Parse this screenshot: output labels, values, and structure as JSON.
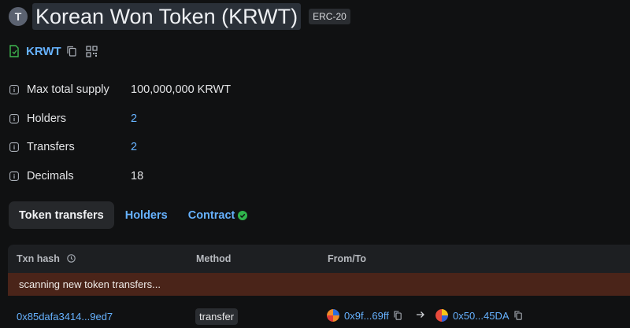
{
  "header": {
    "avatar_letter": "T",
    "title": "Korean Won Token (KRWT)",
    "badge": "ERC-20"
  },
  "address": {
    "label": "KRWT"
  },
  "properties": [
    {
      "label": "Max total supply",
      "value": "100,000,000 KRWT"
    },
    {
      "label": "Holders",
      "value": "2"
    },
    {
      "label": "Transfers",
      "value": "2"
    },
    {
      "label": "Decimals",
      "value": "18"
    }
  ],
  "tabs": [
    {
      "label": "Token transfers"
    },
    {
      "label": "Holders"
    },
    {
      "label": "Contract"
    }
  ],
  "table": {
    "headers": {
      "txn_hash": "Txn hash",
      "method": "Method",
      "from_to": "From/To"
    },
    "scan_notice": "scanning new token transfers...",
    "rows": [
      {
        "hash": "0x85dafa3414...9ed7",
        "method": "transfer",
        "from": "0x9f...69ff",
        "to": "0x50...45DA"
      }
    ]
  },
  "colors": {
    "background": "#101112",
    "link": "#66b2ff",
    "notice": "#4a2419",
    "verified": "#2fb44b"
  }
}
